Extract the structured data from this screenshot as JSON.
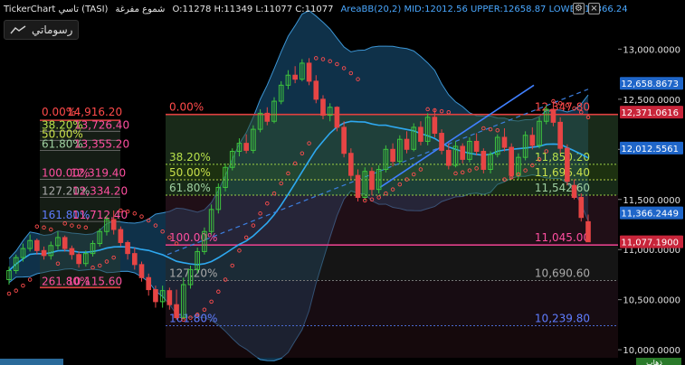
{
  "header": {
    "symbol": "TickerChart تاسي (TASI)",
    "period": "شموع مفرغة",
    "ohlc": "O:11278  H:11349  L:11077  C:11077",
    "indicator": "AreaBB(20,2)  MID:12012.56  UPPER:12658.87  LOWER:11366.24",
    "settings_glyph": "⚙",
    "close_glyph": "×"
  },
  "drawing_button": {
    "label": "رسوماتي",
    "icon": "trendline-icon"
  },
  "price_axis": {
    "ticks": [
      "13,000.0000",
      "12,500.0000",
      "12,000.0000",
      "11,500.0000",
      "11,000.0000",
      "10,500.0000",
      "10,000.0000"
    ],
    "tags": {
      "upper": "12,658.8673",
      "fib0": "12,371.0616",
      "mid": "12,012.5561",
      "lower": "11,366.2449",
      "last": "11,077.1900"
    },
    "bottom_tag": "ذهاب"
  },
  "colors": {
    "up": "#3ec43e",
    "down": "#e64545",
    "band": "#1c5a85",
    "mid": "#2ea8f0",
    "sar": "#ff4d4d",
    "fib_red": "#e04040",
    "tag_blue": "#1f66c9",
    "tag_red": "#c8253a"
  },
  "fib_right": {
    "labels_left": [
      "0.00%",
      "38.20%",
      "50.00%",
      "61.80%",
      "100.00%",
      "127.20%",
      "161.80%"
    ],
    "labels_right": [
      "12,347.80",
      "11,850.20",
      "11,696.40",
      "11,542.60",
      "11,045.00",
      "10,690.60",
      "10,239.80"
    ]
  },
  "fib_left": {
    "texts": [
      "0.00%",
      "14,916.20",
      "38.20%",
      "13,726.40",
      "50.00%",
      "61.80%",
      "13,355.20",
      "100.00%",
      "12,319.40",
      "127.20%",
      "12,334.20",
      "161.80%",
      "11,712.40",
      "261.80%",
      "10,115.60"
    ]
  },
  "chart_data": {
    "type": "candlestick",
    "ylim": [
      9920,
      13310
    ],
    "y_ticks": [
      13000,
      12500,
      12000,
      11500,
      11000,
      10500,
      10000
    ],
    "last_ohlc": {
      "open": 11278,
      "high": 11349,
      "low": 11077,
      "close": 11077
    },
    "bollinger": {
      "period": 20,
      "dev": 2,
      "mid": 12012.56,
      "upper": 12658.87,
      "lower": 11366.24
    },
    "series": [
      {
        "name": "candles",
        "values": [
          [
            10700,
            10830,
            10650,
            10790
          ],
          [
            10790,
            10950,
            10760,
            10920
          ],
          [
            10920,
            11060,
            10880,
            11010
          ],
          [
            11010,
            11150,
            10980,
            11090
          ],
          [
            11090,
            11110,
            10950,
            10990
          ],
          [
            10990,
            11030,
            10900,
            10940
          ],
          [
            10940,
            11080,
            10900,
            11040
          ],
          [
            11040,
            11180,
            11000,
            11120
          ],
          [
            11120,
            11140,
            10980,
            11010
          ],
          [
            11010,
            11040,
            10900,
            10950
          ],
          [
            10950,
            10980,
            10820,
            10860
          ],
          [
            10860,
            10990,
            10830,
            10960
          ],
          [
            10960,
            11090,
            10930,
            11060
          ],
          [
            11060,
            11210,
            11030,
            11180
          ],
          [
            11180,
            11340,
            11140,
            11300
          ],
          [
            11300,
            11390,
            11150,
            11200
          ],
          [
            11200,
            11230,
            11030,
            11070
          ],
          [
            11070,
            11090,
            10900,
            10960
          ],
          [
            10960,
            11020,
            10800,
            10850
          ],
          [
            10850,
            10880,
            10680,
            10720
          ],
          [
            10720,
            10760,
            10540,
            10600
          ],
          [
            10600,
            10640,
            10420,
            10480
          ],
          [
            10480,
            10640,
            10420,
            10590
          ],
          [
            10590,
            10620,
            10400,
            10450
          ],
          [
            10450,
            10600,
            10300,
            10320
          ],
          [
            10320,
            10720,
            10300,
            10650
          ],
          [
            10650,
            10840,
            10610,
            10800
          ],
          [
            10800,
            11020,
            10760,
            10980
          ],
          [
            10980,
            11220,
            10950,
            11180
          ],
          [
            11180,
            11450,
            11150,
            11400
          ],
          [
            11400,
            11660,
            11360,
            11620
          ],
          [
            11620,
            11860,
            11580,
            11820
          ],
          [
            11820,
            12010,
            11790,
            11980
          ],
          [
            11980,
            12110,
            11930,
            12060
          ],
          [
            12060,
            12150,
            11960,
            11990
          ],
          [
            11990,
            12240,
            11960,
            12200
          ],
          [
            12200,
            12400,
            12170,
            12360
          ],
          [
            12360,
            12420,
            12240,
            12280
          ],
          [
            12280,
            12520,
            12260,
            12480
          ],
          [
            12480,
            12680,
            12450,
            12640
          ],
          [
            12640,
            12790,
            12600,
            12740
          ],
          [
            12740,
            12830,
            12660,
            12700
          ],
          [
            12700,
            12900,
            12680,
            12860
          ],
          [
            12860,
            12910,
            12640,
            12680
          ],
          [
            12680,
            12740,
            12460,
            12500
          ],
          [
            12500,
            12540,
            12300,
            12340
          ],
          [
            12340,
            12460,
            12280,
            12420
          ],
          [
            12420,
            12430,
            12180,
            12220
          ],
          [
            12220,
            12280,
            11920,
            11960
          ],
          [
            11960,
            12010,
            11700,
            11740
          ],
          [
            11740,
            11800,
            11480,
            11520
          ],
          [
            11520,
            11820,
            11490,
            11780
          ],
          [
            11780,
            11820,
            11540,
            11600
          ],
          [
            11600,
            11840,
            11560,
            11800
          ],
          [
            11800,
            12040,
            11770,
            12000
          ],
          [
            12000,
            12060,
            11830,
            11880
          ],
          [
            11880,
            12140,
            11850,
            12100
          ],
          [
            12100,
            12180,
            11960,
            12000
          ],
          [
            12000,
            12260,
            11980,
            12220
          ],
          [
            12220,
            12280,
            12040,
            12080
          ],
          [
            12080,
            12360,
            12040,
            12320
          ],
          [
            12320,
            12400,
            12120,
            12160
          ],
          [
            12160,
            12200,
            11950,
            11990
          ],
          [
            11990,
            12060,
            11800,
            11840
          ],
          [
            11840,
            12080,
            11820,
            12030
          ],
          [
            12030,
            12060,
            11860,
            11900
          ],
          [
            11900,
            12120,
            11870,
            12080
          ],
          [
            12080,
            12160,
            11940,
            11980
          ],
          [
            11980,
            12010,
            11760,
            11800
          ],
          [
            11800,
            11980,
            11760,
            11950
          ],
          [
            11950,
            12150,
            11920,
            12120
          ],
          [
            12120,
            12210,
            11980,
            12020
          ],
          [
            12020,
            12060,
            11700,
            11740
          ],
          [
            11740,
            11960,
            11700,
            11920
          ],
          [
            11920,
            12180,
            11890,
            12140
          ],
          [
            12140,
            12220,
            12000,
            12040
          ],
          [
            12040,
            12320,
            12010,
            12280
          ],
          [
            12280,
            12440,
            12250,
            12400
          ],
          [
            12400,
            12480,
            12230,
            12270
          ],
          [
            12270,
            12320,
            11960,
            12010
          ],
          [
            12010,
            12050,
            11640,
            11680
          ],
          [
            11640,
            11700,
            11500,
            11520
          ],
          [
            11520,
            11560,
            11280,
            11320
          ],
          [
            11278,
            11349,
            11077,
            11077
          ]
        ]
      },
      {
        "name": "parabolic-sar",
        "values": [
          10560,
          10590,
          10640,
          10700,
          11230,
          11220,
          11200,
          10860,
          11260,
          11240,
          11230,
          11220,
          10820,
          10840,
          10880,
          10920,
          11390,
          11380,
          11360,
          11330,
          11290,
          11240,
          11180,
          11120,
          11060,
          10300,
          10320,
          10350,
          10400,
          10480,
          10580,
          10700,
          10840,
          10990,
          11120,
          11240,
          11360,
          11460,
          11560,
          11660,
          11760,
          11860,
          11960,
          12060,
          12910,
          12900,
          12880,
          12850,
          12810,
          12760,
          12700,
          11490,
          11500,
          11520,
          11560,
          11600,
          11650,
          11700,
          11750,
          11800,
          12400,
          12390,
          12380,
          12370,
          11760,
          11770,
          11790,
          11810,
          12210,
          12200,
          12190,
          11700,
          11720,
          11750,
          11790,
          11840,
          11900,
          11980,
          12480,
          12460,
          12440,
          12410,
          12370,
          12320
        ]
      }
    ]
  }
}
